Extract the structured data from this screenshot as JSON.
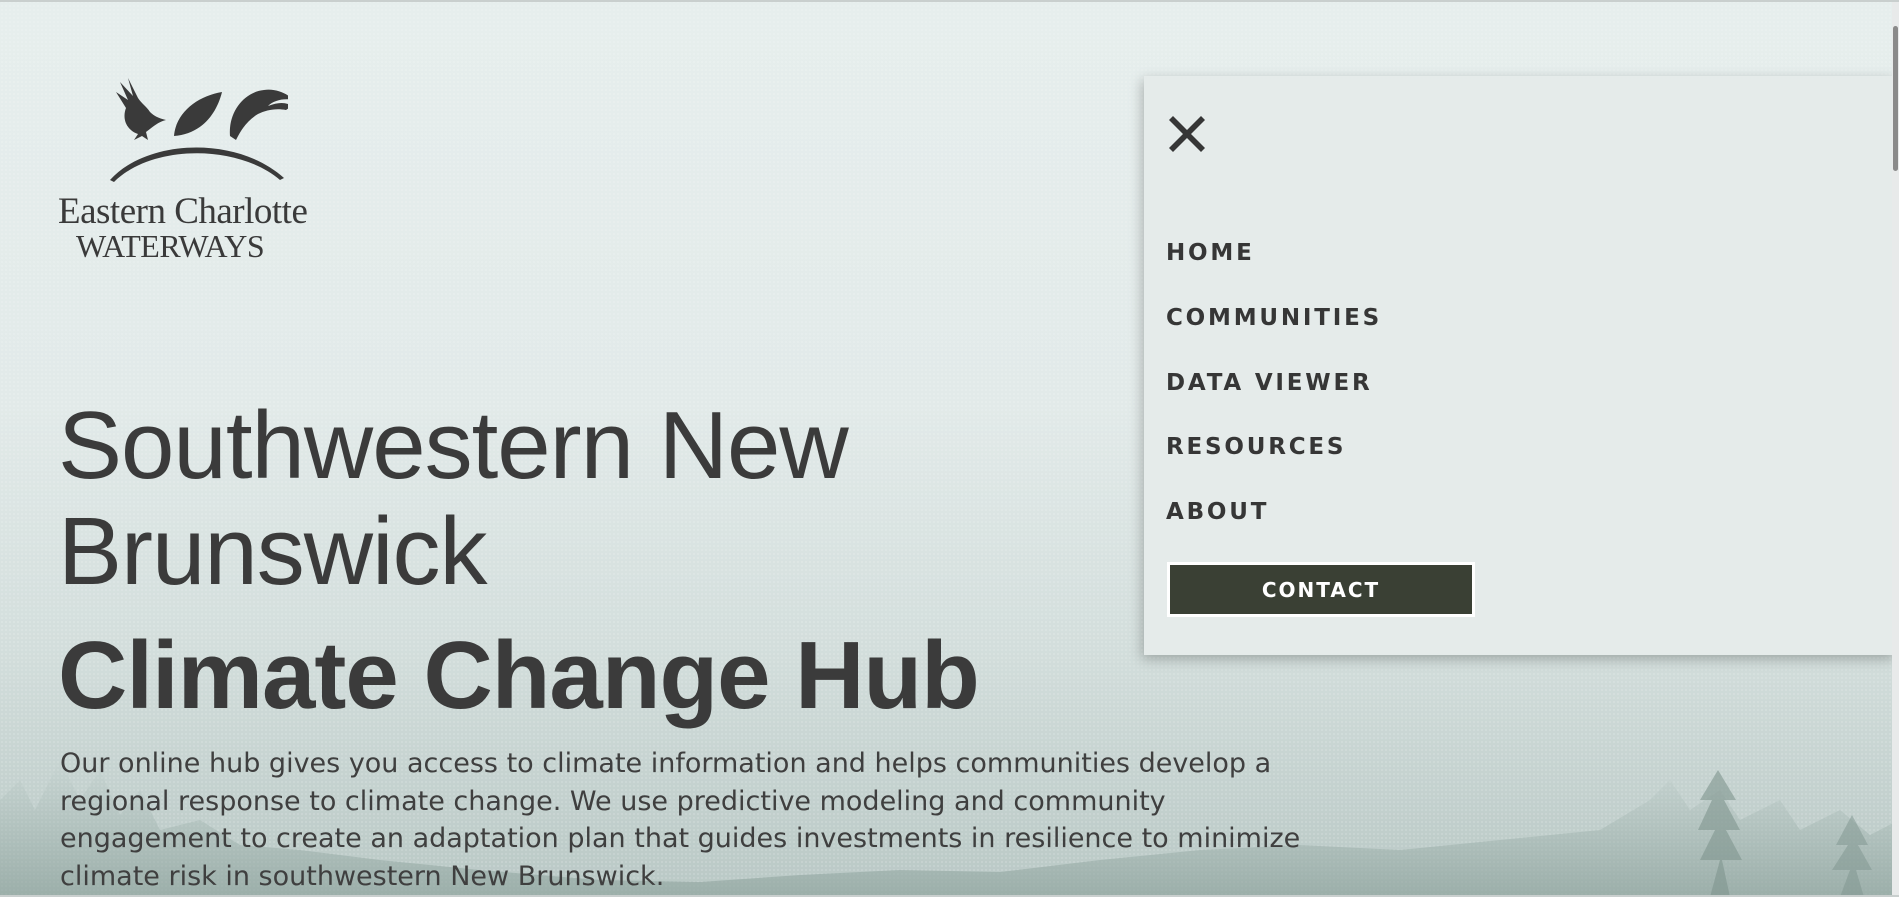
{
  "brand": {
    "name_line1": "Eastern Charlotte",
    "name_line2": "WATERWAYS",
    "logo_icons": [
      "bird-icon",
      "leaf-icon",
      "fish-icon"
    ]
  },
  "hero": {
    "headline": "Southwestern New Brunswick",
    "title": "Climate Change Hub",
    "intro": "Our online hub gives you access to climate information and helps communities develop a regional response to climate change.  We use predictive modeling and community engagement to create an adaptation plan that guides investments in resilience to minimize climate risk in southwestern New Brunswick."
  },
  "menu": {
    "close_icon": "close-icon",
    "items": [
      {
        "label": "HOME"
      },
      {
        "label": "COMMUNITIES"
      },
      {
        "label": "DATA VIEWER"
      },
      {
        "label": "RESOURCES"
      },
      {
        "label": "ABOUT"
      }
    ],
    "contact_label": "CONTACT"
  },
  "colors": {
    "text": "#3b3b3b",
    "menu_bg": "#e5ebea",
    "button_bg": "#3a4034",
    "button_text": "#ffffff"
  }
}
